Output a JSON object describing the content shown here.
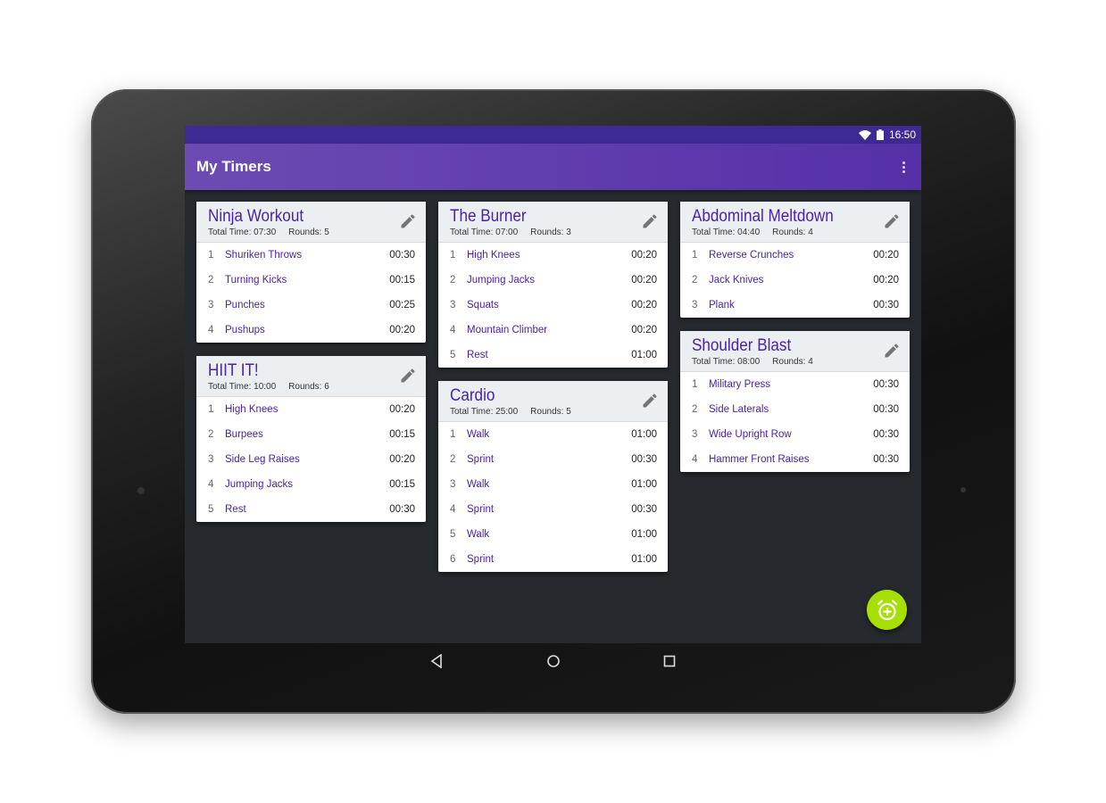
{
  "status_bar": {
    "time": "16:50",
    "icons": [
      "wifi-icon",
      "battery-icon"
    ]
  },
  "app_bar": {
    "title": "My Timers",
    "menu_icon": "more-vert-icon"
  },
  "colors": {
    "primary": "#5530a8",
    "status": "#3f2a94",
    "accent": "#a6e000",
    "item_text": "#4a22a8",
    "background": "#262a2e"
  },
  "total_label": "Total Time:",
  "rounds_label": "Rounds:",
  "timers": [
    {
      "title": "Ninja Workout",
      "total": "07:30",
      "rounds": "5",
      "items": [
        {
          "n": "1",
          "name": "Shuriken Throws",
          "t": "00:30"
        },
        {
          "n": "2",
          "name": "Turning Kicks",
          "t": "00:15"
        },
        {
          "n": "3",
          "name": "Punches",
          "t": "00:25"
        },
        {
          "n": "4",
          "name": "Pushups",
          "t": "00:20"
        }
      ]
    },
    {
      "title": "HIIT IT!",
      "total": "10:00",
      "rounds": "6",
      "items": [
        {
          "n": "1",
          "name": "High Knees",
          "t": "00:20"
        },
        {
          "n": "2",
          "name": "Burpees",
          "t": "00:15"
        },
        {
          "n": "3",
          "name": "Side Leg Raises",
          "t": "00:20"
        },
        {
          "n": "4",
          "name": "Jumping Jacks",
          "t": "00:15"
        },
        {
          "n": "5",
          "name": "Rest",
          "t": "00:30"
        }
      ]
    },
    {
      "title": "The Burner",
      "total": "07:00",
      "rounds": "3",
      "items": [
        {
          "n": "1",
          "name": "High Knees",
          "t": "00:20"
        },
        {
          "n": "2",
          "name": "Jumping Jacks",
          "t": "00:20"
        },
        {
          "n": "3",
          "name": "Squats",
          "t": "00:20"
        },
        {
          "n": "4",
          "name": "Mountain Climber",
          "t": "00:20"
        },
        {
          "n": "5",
          "name": "Rest",
          "t": "01:00"
        }
      ]
    },
    {
      "title": "Cardio",
      "total": "25:00",
      "rounds": "5",
      "items": [
        {
          "n": "1",
          "name": "Walk",
          "t": "01:00"
        },
        {
          "n": "2",
          "name": "Sprint",
          "t": "00:30"
        },
        {
          "n": "3",
          "name": "Walk",
          "t": "01:00"
        },
        {
          "n": "4",
          "name": "Sprint",
          "t": "00:30"
        },
        {
          "n": "5",
          "name": "Walk",
          "t": "01:00"
        },
        {
          "n": "6",
          "name": "Sprint",
          "t": "01:00"
        }
      ]
    },
    {
      "title": "Abdominal Meltdown",
      "total": "04:40",
      "rounds": "4",
      "items": [
        {
          "n": "1",
          "name": "Reverse Crunches",
          "t": "00:20"
        },
        {
          "n": "2",
          "name": "Jack Knives",
          "t": "00:20"
        },
        {
          "n": "3",
          "name": "Plank",
          "t": "00:30"
        }
      ]
    },
    {
      "title": "Shoulder Blast",
      "total": "08:00",
      "rounds": "4",
      "items": [
        {
          "n": "1",
          "name": "Military Press",
          "t": "00:30"
        },
        {
          "n": "2",
          "name": "Side Laterals",
          "t": "00:30"
        },
        {
          "n": "3",
          "name": "Wide Upright Row",
          "t": "00:30"
        },
        {
          "n": "4",
          "name": "Hammer Front Raises",
          "t": "00:30"
        }
      ]
    }
  ],
  "fab": {
    "icon": "add-alarm-icon"
  },
  "nav_bar": {
    "icons": [
      "back-icon",
      "home-icon",
      "recents-icon"
    ]
  }
}
